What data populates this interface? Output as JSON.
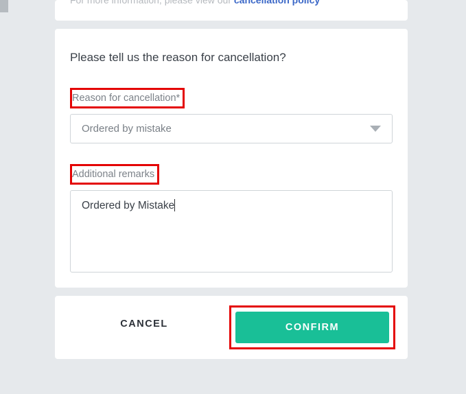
{
  "topInfo": {
    "prefix": "For more information, please view our ",
    "linkText": "cancellation policy"
  },
  "form": {
    "heading": "Please tell us the reason for cancellation?",
    "reasonLabel": "Reason for cancellation*",
    "reasonSelected": "Ordered by mistake",
    "remarksLabel": "Additional remarks",
    "remarksValue": "Ordered by Mistake"
  },
  "buttons": {
    "cancel": "CANCEL",
    "confirm": "CONFIRM"
  }
}
